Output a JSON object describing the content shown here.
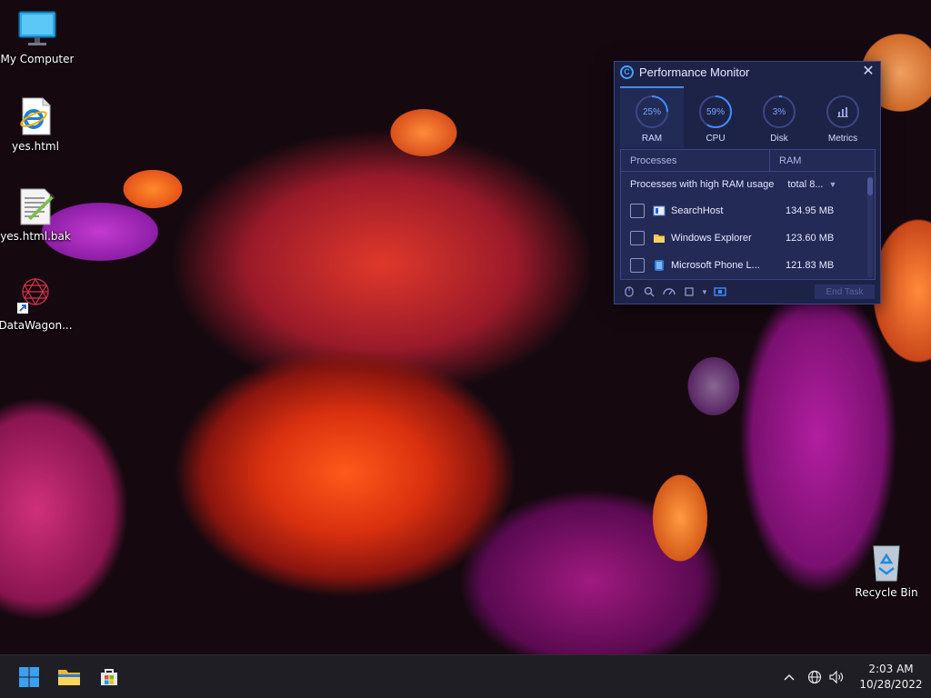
{
  "desktop": {
    "icons": [
      {
        "label": "My Computer"
      },
      {
        "label": "yes.html"
      },
      {
        "label": "yes.html.bak"
      },
      {
        "label": "DataWagon..."
      },
      {
        "label": "Recycle Bin"
      }
    ]
  },
  "perf_monitor": {
    "title": "Performance Monitor",
    "tabs": [
      {
        "label": "RAM",
        "value": "25%",
        "fraction": 0.25
      },
      {
        "label": "CPU",
        "value": "59%",
        "fraction": 0.59
      },
      {
        "label": "Disk",
        "value": "3%",
        "fraction": 0.03
      },
      {
        "label": "Metrics"
      }
    ],
    "table": {
      "columns": [
        "Processes",
        "RAM"
      ],
      "group_label": "Processes with high RAM usage",
      "group_total": "total 8...",
      "rows": [
        {
          "name": "SearchHost",
          "ram": "134.95 MB"
        },
        {
          "name": "Windows Explorer",
          "ram": "123.60 MB"
        },
        {
          "name": "Microsoft Phone L...",
          "ram": "121.83 MB"
        }
      ]
    },
    "end_task_label": "End Task",
    "colors": {
      "accent": "#3f8cff",
      "background": "#1d2347"
    }
  },
  "taskbar": {
    "time": "2:03 AM",
    "date": "10/28/2022"
  }
}
